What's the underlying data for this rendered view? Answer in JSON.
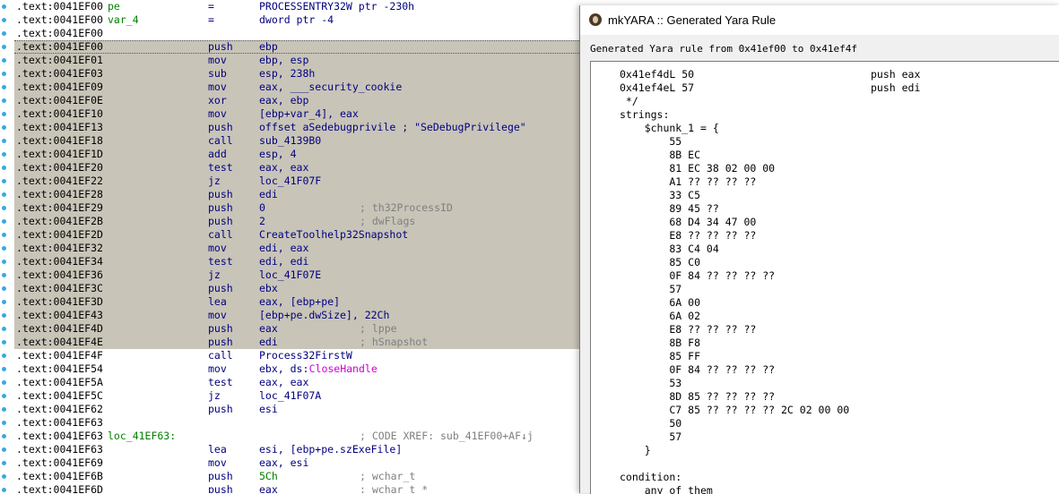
{
  "ida": {
    "lines": [
      {
        "addr": ".text:0041EF00",
        "label": "pe",
        "mn": "=",
        "op": "PROCESSENTRY32W ptr -230h",
        "cm": "",
        "sel": false
      },
      {
        "addr": ".text:0041EF00",
        "label": "var_4",
        "mn": "=",
        "op": "dword ptr -4",
        "cm": "",
        "sel": false
      },
      {
        "addr": ".text:0041EF00",
        "label": "",
        "mn": "",
        "op": "",
        "cm": "",
        "sel": false
      },
      {
        "addr": ".text:0041EF00",
        "label": "",
        "mn": "push",
        "op": "ebp",
        "cm": "",
        "sel": true,
        "first": true
      },
      {
        "addr": ".text:0041EF01",
        "label": "",
        "mn": "mov",
        "op": "ebp, esp",
        "cm": "",
        "sel": true
      },
      {
        "addr": ".text:0041EF03",
        "label": "",
        "mn": "sub",
        "op": "esp, 238h",
        "cm": "",
        "sel": true
      },
      {
        "addr": ".text:0041EF09",
        "label": "",
        "mn": "mov",
        "op": "eax, ___security_cookie",
        "cm": "",
        "sel": true
      },
      {
        "addr": ".text:0041EF0E",
        "label": "",
        "mn": "xor",
        "op": "eax, ebp",
        "cm": "",
        "sel": true
      },
      {
        "addr": ".text:0041EF10",
        "label": "",
        "mn": "mov",
        "op": "[ebp+var_4], eax",
        "cm": "",
        "sel": true
      },
      {
        "addr": ".text:0041EF13",
        "label": "",
        "mn": "push",
        "op": "offset aSedebugprivile ; \"SeDebugPrivilege\"",
        "cm": "",
        "sel": true
      },
      {
        "addr": ".text:0041EF18",
        "label": "",
        "mn": "call",
        "op": "sub_4139B0",
        "cm": "",
        "sel": true
      },
      {
        "addr": ".text:0041EF1D",
        "label": "",
        "mn": "add",
        "op": "esp, 4",
        "cm": "",
        "sel": true
      },
      {
        "addr": ".text:0041EF20",
        "label": "",
        "mn": "test",
        "op": "eax, eax",
        "cm": "",
        "sel": true
      },
      {
        "addr": ".text:0041EF22",
        "label": "",
        "mn": "jz",
        "op": "loc_41F07F",
        "cm": "",
        "sel": true
      },
      {
        "addr": ".text:0041EF28",
        "label": "",
        "mn": "push",
        "op": "edi",
        "cm": "",
        "sel": true
      },
      {
        "addr": ".text:0041EF29",
        "label": "",
        "mn": "push",
        "op": "0",
        "cm": "; th32ProcessID",
        "sel": true
      },
      {
        "addr": ".text:0041EF2B",
        "label": "",
        "mn": "push",
        "op": "2",
        "cm": "; dwFlags",
        "sel": true
      },
      {
        "addr": ".text:0041EF2D",
        "label": "",
        "mn": "call",
        "op": "CreateToolhelp32Snapshot",
        "cm": "",
        "sel": true
      },
      {
        "addr": ".text:0041EF32",
        "label": "",
        "mn": "mov",
        "op": "edi, eax",
        "cm": "",
        "sel": true
      },
      {
        "addr": ".text:0041EF34",
        "label": "",
        "mn": "test",
        "op": "edi, edi",
        "cm": "",
        "sel": true
      },
      {
        "addr": ".text:0041EF36",
        "label": "",
        "mn": "jz",
        "op": "loc_41F07E",
        "cm": "",
        "sel": true
      },
      {
        "addr": ".text:0041EF3C",
        "label": "",
        "mn": "push",
        "op": "ebx",
        "cm": "",
        "sel": true
      },
      {
        "addr": ".text:0041EF3D",
        "label": "",
        "mn": "lea",
        "op": "eax, [ebp+pe]",
        "cm": "",
        "sel": true
      },
      {
        "addr": ".text:0041EF43",
        "label": "",
        "mn": "mov",
        "op": "[ebp+pe.dwSize], 22Ch",
        "cm": "",
        "sel": true
      },
      {
        "addr": ".text:0041EF4D",
        "label": "",
        "mn": "push",
        "op": "eax",
        "cm": "; lppe",
        "sel": true
      },
      {
        "addr": ".text:0041EF4E",
        "label": "",
        "mn": "push",
        "op": "edi",
        "cm": "; hSnapshot",
        "sel": true
      },
      {
        "addr": ".text:0041EF4F",
        "label": "",
        "mn": "call",
        "op": "Process32FirstW",
        "cm": "",
        "sel": false
      },
      {
        "addr": ".text:0041EF54",
        "label": "",
        "mn": "mov",
        "op": "ebx, ds:",
        "op2": "CloseHandle",
        "cm": "",
        "sel": false
      },
      {
        "addr": ".text:0041EF5A",
        "label": "",
        "mn": "test",
        "op": "eax, eax",
        "cm": "",
        "sel": false
      },
      {
        "addr": ".text:0041EF5C",
        "label": "",
        "mn": "jz",
        "op": "loc_41F07A",
        "cm": "",
        "sel": false
      },
      {
        "addr": ".text:0041EF62",
        "label": "",
        "mn": "push",
        "op": "esi",
        "cm": "",
        "sel": false
      },
      {
        "addr": ".text:0041EF63",
        "label": "",
        "mn": "",
        "op": "",
        "cm": "",
        "sel": false
      },
      {
        "addr": ".text:0041EF63",
        "label": "loc_41EF63:",
        "mn": "",
        "op": "",
        "cm": "; CODE XREF: sub_41EF00+AF↓j",
        "sel": false,
        "green": true
      },
      {
        "addr": ".text:0041EF63",
        "label": "",
        "mn": "lea",
        "op": "esi, [ebp+pe.szExeFile]",
        "cm": "",
        "sel": false
      },
      {
        "addr": ".text:0041EF69",
        "label": "",
        "mn": "mov",
        "op": "eax, esi",
        "cm": "",
        "sel": false
      },
      {
        "addr": ".text:0041EF6B",
        "label": "",
        "mn": "push",
        "op": "5Ch",
        "cm": "; wchar_t",
        "sel": false,
        "opgreen": true
      },
      {
        "addr": ".text:0041EF6D",
        "label": "",
        "mn": "push",
        "op": "eax",
        "cm": "; wchar_t *",
        "sel": false
      }
    ]
  },
  "yara_window": {
    "title": "mkYARA :: Generated Yara Rule",
    "caption": "Generated Yara rule from 0x41ef00 to 0x41ef4f",
    "lines": [
      {
        "a": "0x41ef4dL 50",
        "b": "push eax"
      },
      {
        "a": "0x41ef4eL 57",
        "b": "push edi"
      },
      {
        "a": " */",
        "b": ""
      },
      {
        "a": "strings:",
        "b": ""
      },
      {
        "a": "    $chunk_1 = {",
        "b": ""
      },
      {
        "a": "        55",
        "b": ""
      },
      {
        "a": "        8B EC",
        "b": ""
      },
      {
        "a": "        81 EC 38 02 00 00",
        "b": ""
      },
      {
        "a": "        A1 ?? ?? ?? ??",
        "b": ""
      },
      {
        "a": "        33 C5",
        "b": ""
      },
      {
        "a": "        89 45 ??",
        "b": ""
      },
      {
        "a": "        68 D4 34 47 00",
        "b": ""
      },
      {
        "a": "        E8 ?? ?? ?? ??",
        "b": ""
      },
      {
        "a": "        83 C4 04",
        "b": ""
      },
      {
        "a": "        85 C0",
        "b": ""
      },
      {
        "a": "        0F 84 ?? ?? ?? ??",
        "b": ""
      },
      {
        "a": "        57",
        "b": ""
      },
      {
        "a": "        6A 00",
        "b": ""
      },
      {
        "a": "        6A 02",
        "b": ""
      },
      {
        "a": "        E8 ?? ?? ?? ??",
        "b": ""
      },
      {
        "a": "        8B F8",
        "b": ""
      },
      {
        "a": "        85 FF",
        "b": ""
      },
      {
        "a": "        0F 84 ?? ?? ?? ??",
        "b": ""
      },
      {
        "a": "        53",
        "b": ""
      },
      {
        "a": "        8D 85 ?? ?? ?? ??",
        "b": ""
      },
      {
        "a": "        C7 85 ?? ?? ?? ?? 2C 02 00 00",
        "b": ""
      },
      {
        "a": "        50",
        "b": ""
      },
      {
        "a": "        57",
        "b": ""
      },
      {
        "a": "    }",
        "b": ""
      },
      {
        "a": "",
        "b": ""
      },
      {
        "a": "condition:",
        "b": ""
      },
      {
        "a": "    any of them",
        "b": ""
      }
    ]
  },
  "colors": {
    "selection": "#c8c4b8",
    "keyword": "#00007f",
    "comment": "#7f7f7f",
    "label_green": "#008000",
    "import_magenta": "#d000d0",
    "gutter_dot": "#39a9e0"
  }
}
